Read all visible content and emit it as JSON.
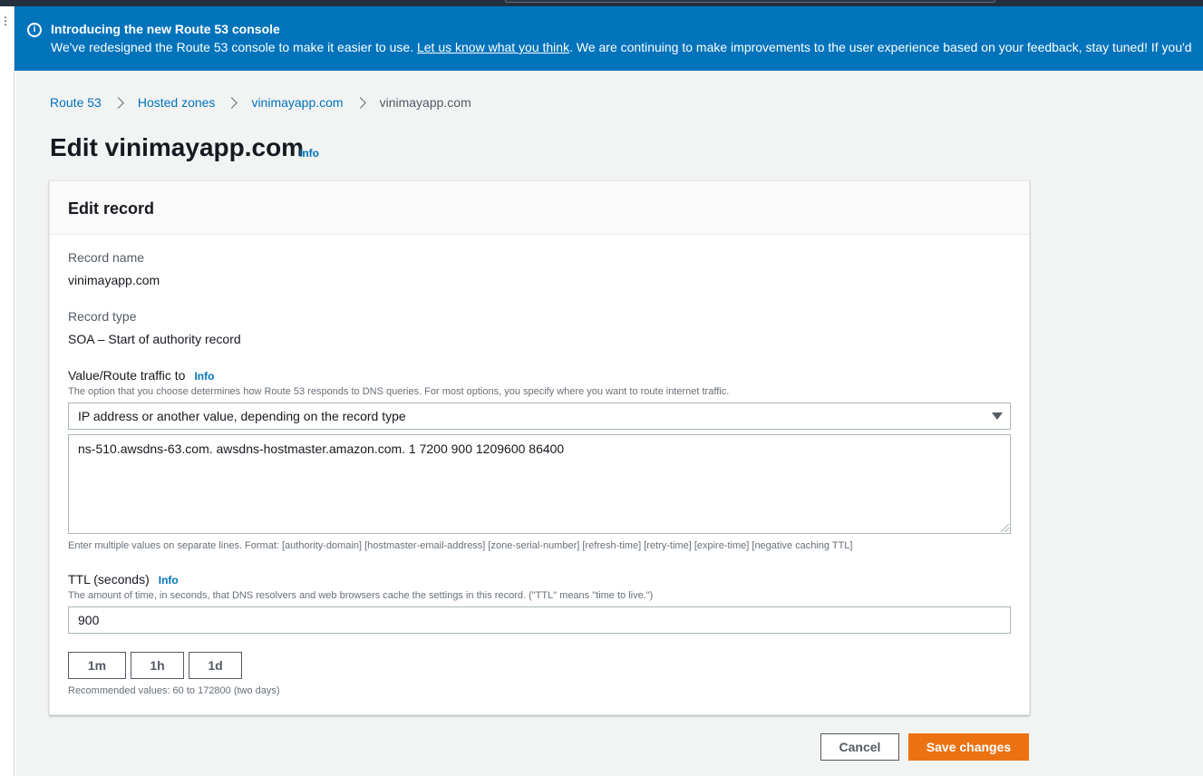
{
  "banner": {
    "title": "Introducing the new Route 53 console",
    "text_before": "We've redesigned the Route 53 console to make it easier to use. ",
    "link": "Let us know what you think",
    "text_after": ". We are continuing to make improvements to the user experience based on your feedback, stay tuned! If you'd",
    "icon": "info-icon"
  },
  "breadcrumb": {
    "items": [
      "Route 53",
      "Hosted zones",
      "vinimayapp.com"
    ],
    "current": "vinimayapp.com"
  },
  "page": {
    "title": "Edit vinimayapp.com",
    "info": "Info"
  },
  "card": {
    "header": "Edit record",
    "record_name_label": "Record name",
    "record_name_value": "vinimayapp.com",
    "record_type_label": "Record type",
    "record_type_value": "SOA – Start of authority record",
    "value_label": "Value/Route traffic to",
    "value_info": "Info",
    "value_desc": "The option that you choose determines how Route 53 responds to DNS queries. For most options, you specify where you want to route internet traffic.",
    "value_select": "IP address or another value, depending on the record type",
    "value_text": "ns-510.awsdns-63.com. awsdns-hostmaster.amazon.com. 1 7200 900 1209600 86400",
    "value_hint": "Enter multiple values on separate lines. Format: [authority-domain] [hostmaster-email-address] [zone-serial-number] [refresh-time] [retry-time] [expire-time] [negative caching TTL]",
    "ttl_label": "TTL (seconds)",
    "ttl_info": "Info",
    "ttl_desc": "The amount of time, in seconds, that DNS resolvers and web browsers cache the settings in this record. (\"TTL\" means \"time to live.\")",
    "ttl_value": "900",
    "ttl_presets": [
      "1m",
      "1h",
      "1d"
    ],
    "ttl_hint": "Recommended values: 60 to 172800 (two days)"
  },
  "actions": {
    "cancel": "Cancel",
    "save": "Save changes"
  },
  "colors": {
    "banner": "#0073bb",
    "primary_button": "#ec7211",
    "link": "#0073bb"
  }
}
